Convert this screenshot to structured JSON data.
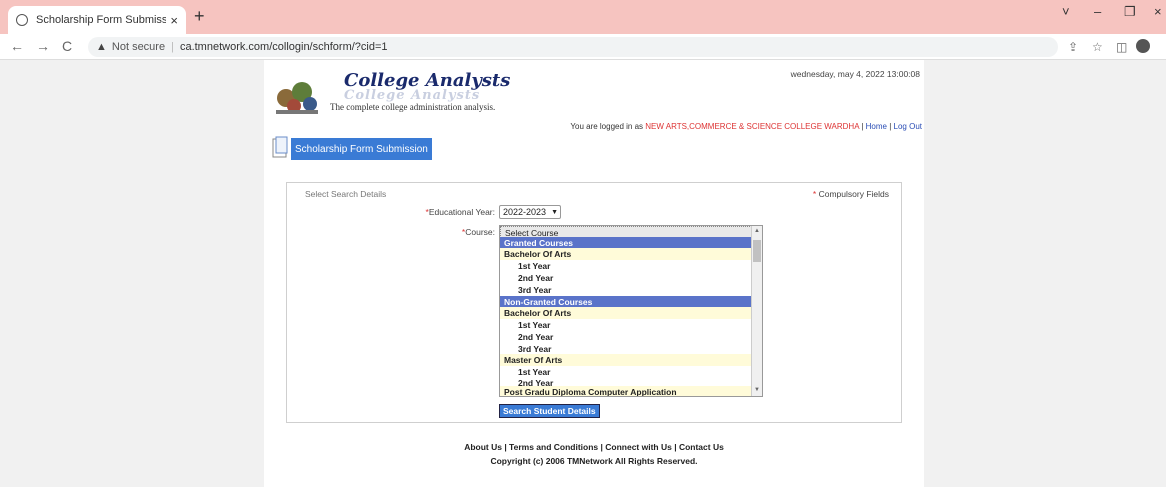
{
  "browser": {
    "tab_title": "Scholarship Form Submission",
    "tab_close": "×",
    "new_tab": "+",
    "nav_back": "←",
    "nav_forward": "→",
    "nav_reload": "C",
    "security_label": "Not secure",
    "url": "ca.tmnetwork.com/collogin/schform/?cid=1",
    "win_minimize_chevron": "˅",
    "win_minimize": "–",
    "win_restore": "❐",
    "win_close": "×",
    "share": "⇪",
    "bookmark": "☆",
    "sidebar": "◫"
  },
  "header": {
    "brand": "College Analysts",
    "tagline": "The complete college administration analysis.",
    "datetime": "wednesday, may 4, 2022 13:00:08",
    "logged_in_prefix": "You are logged in as",
    "college": "NEW ARTS,COMMERCE & SCIENCE COLLEGE WARDHA",
    "sep1": "|",
    "home_link": "Home",
    "sep2": "|",
    "logout_link": "Log Out"
  },
  "form_title": "Scholarship Form Submission",
  "form": {
    "section_label": "Select Search Details",
    "compulsory_mark": "*",
    "compulsory_label": "Compulsory Fields",
    "year_mark": "*",
    "year_label": "Educational Year:",
    "year_value": "2022-2023",
    "course_mark": "*",
    "course_label": "Course:",
    "course_options": [
      "Select Course",
      "Granted Courses",
      "Bachelor Of Arts",
      "1st Year",
      "2nd Year",
      "3rd Year",
      "Non-Granted Courses",
      "Bachelor Of Arts",
      "1st Year",
      "2nd Year",
      "3rd Year",
      "Master Of Arts",
      "1st Year",
      "2nd Year",
      "Post Gradu Diploma Computer Application"
    ],
    "search_button": "Search Student Details"
  },
  "footer": {
    "links": "About Us | Terms and Conditions | Connect with Us | Contact Us",
    "copyright": "Copyright (c) 2006 TMNetwork All Rights Reserved."
  },
  "colors": {
    "tab_bar": "#f6c4c0",
    "banner": "#3a7bd5",
    "header_option": "#5a73c9",
    "group_option": "#fffbd9",
    "highlight_text": "#d33333"
  }
}
